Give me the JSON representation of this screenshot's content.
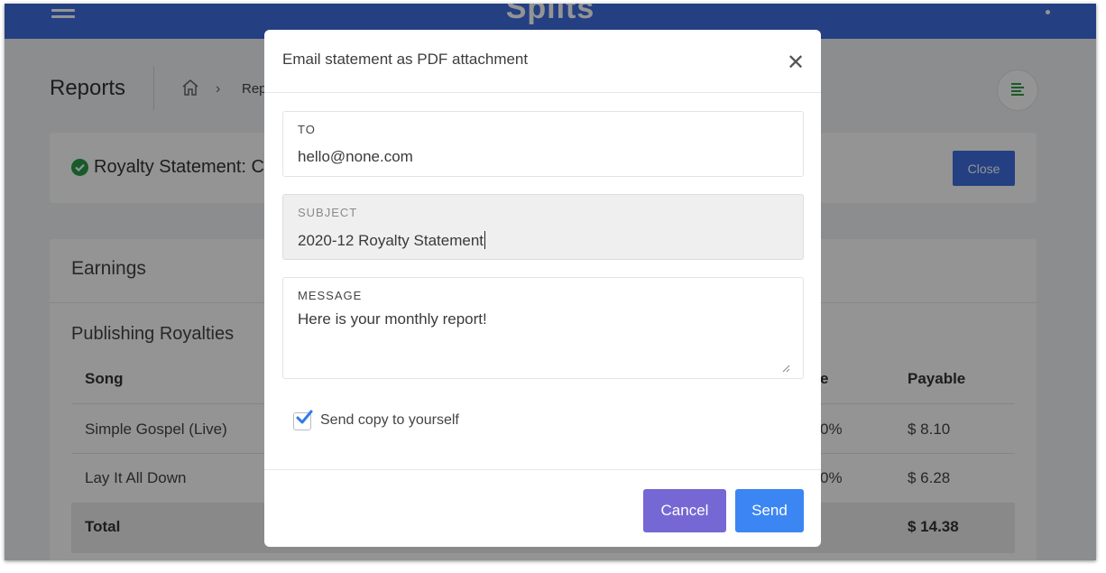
{
  "app": {
    "brand": "Splits"
  },
  "header": {
    "title": "Reports",
    "breadcrumb_partial": "Rep"
  },
  "statement": {
    "title": "Royalty Statement: C",
    "close_label": "Close"
  },
  "earnings": {
    "title": "Earnings",
    "section_title": "Publishing Royalties",
    "columns": {
      "song": "Song",
      "share_partial": "e",
      "payable": "Payable"
    },
    "rows": [
      {
        "song": "Simple Gospel (Live)",
        "share_partial": "0%",
        "payable": "$ 8.10"
      },
      {
        "song": "Lay It All Down",
        "share_partial": "0%",
        "payable": "$ 6.28"
      }
    ],
    "total": {
      "label": "Total",
      "payable": "$ 14.38"
    }
  },
  "modal": {
    "title": "Email statement as PDF attachment",
    "to": {
      "label": "TO",
      "value": "hello@none.com"
    },
    "subject": {
      "label": "SUBJECT",
      "value": "2020-12 Royalty Statement"
    },
    "message": {
      "label": "MESSAGE",
      "value": "Here is your monthly report!"
    },
    "copy_checkbox": {
      "label": "Send copy to yourself",
      "checked": true
    },
    "cancel_label": "Cancel",
    "send_label": "Send"
  },
  "colors": {
    "primary_blue": "#3f6fe0",
    "send_blue": "#3b86f3",
    "cancel_purple": "#7568d4",
    "success_green": "#2a9d4b",
    "checkbox_blue": "#2f7be6"
  }
}
